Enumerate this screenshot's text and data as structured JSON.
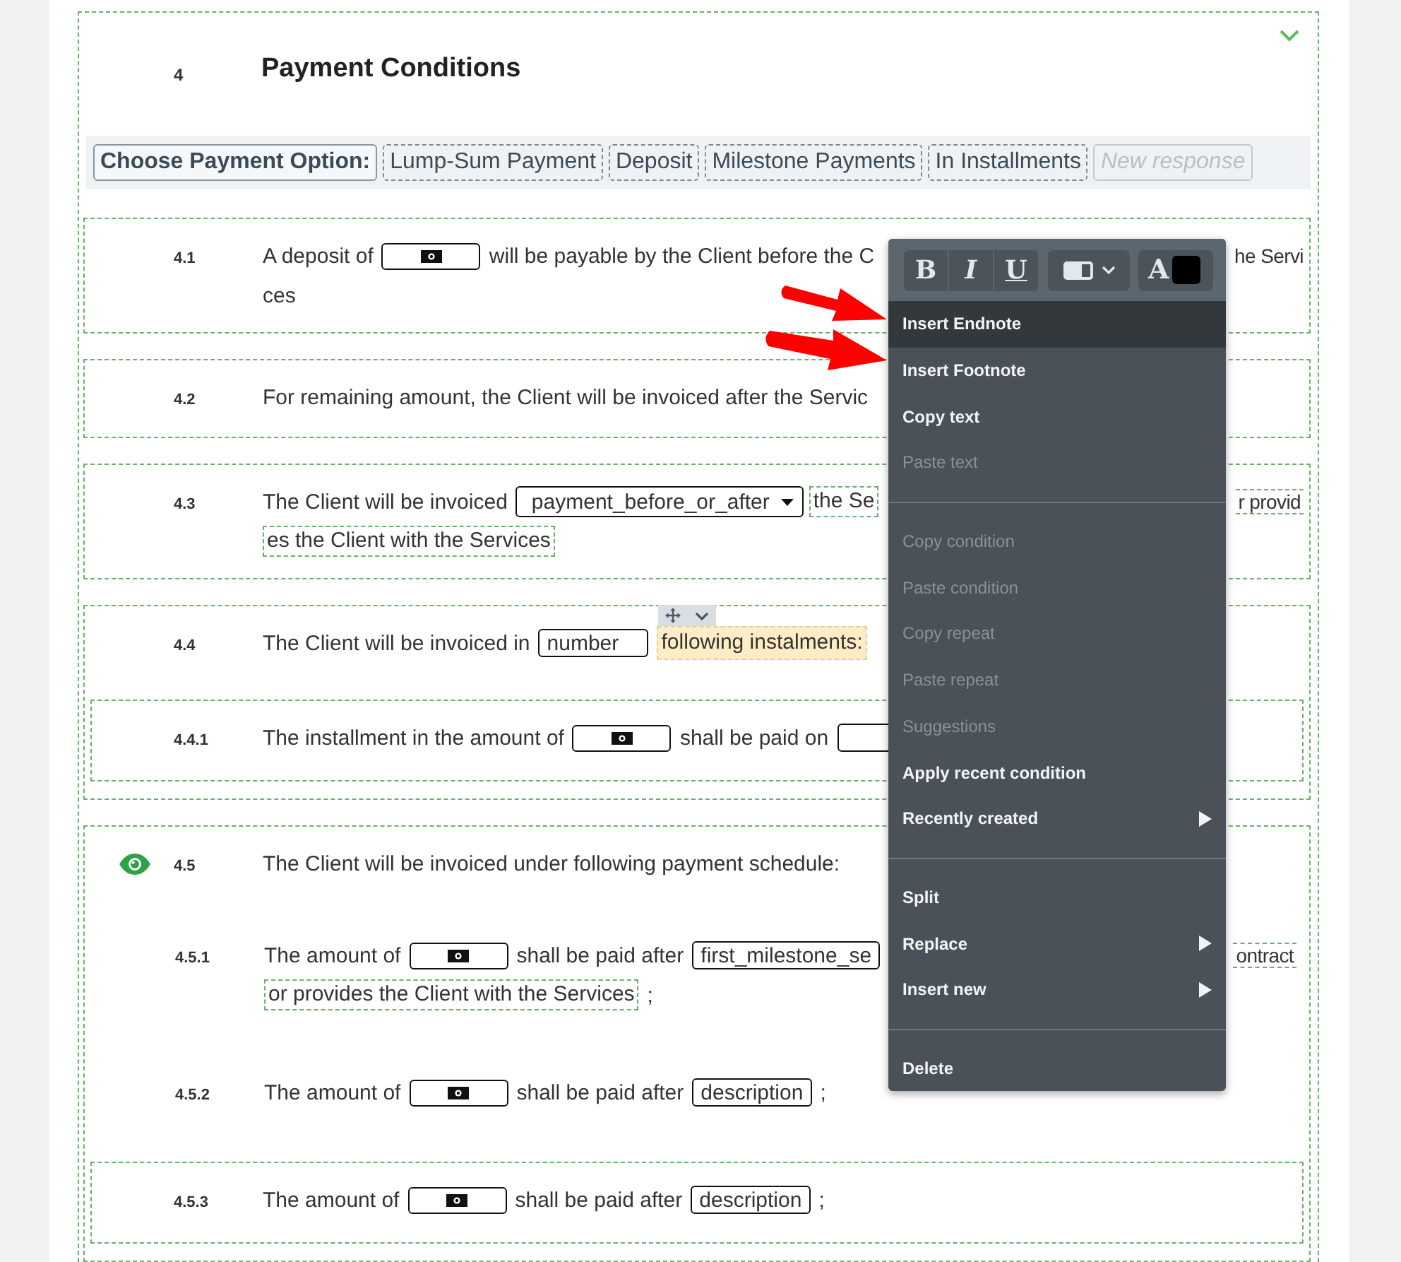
{
  "section": {
    "number": "4",
    "title": "Payment Conditions",
    "collapsed": false
  },
  "option_bar": {
    "label": "Choose Payment Option:",
    "options": [
      {
        "label": "Lump-Sum Payment",
        "kind": "option"
      },
      {
        "label": "Deposit",
        "kind": "option"
      },
      {
        "label": "Milestone Payments",
        "kind": "option"
      },
      {
        "label": "In Installments",
        "kind": "option"
      },
      {
        "label": "New response",
        "kind": "new"
      }
    ]
  },
  "clauses": [
    {
      "number": "4.1",
      "boxed": true,
      "eye": false,
      "lines": [
        {
          "segments": [
            {
              "kind": "text",
              "text": "A deposit of"
            },
            {
              "kind": "money"
            },
            {
              "kind": "text",
              "text": "will be payable by the Client before the C"
            }
          ],
          "tail": {
            "kind": "text",
            "text": "he Servi"
          }
        },
        {
          "segments": [
            {
              "kind": "text",
              "text": "ces"
            }
          ]
        }
      ]
    },
    {
      "number": "4.2",
      "boxed": true,
      "eye": false,
      "lines": [
        {
          "segments": [
            {
              "kind": "text",
              "text": "For remaining amount, the Client will be invoiced after the Servic"
            }
          ]
        }
      ]
    },
    {
      "number": "4.3",
      "boxed": true,
      "eye": false,
      "lines": [
        {
          "segments": [
            {
              "kind": "text",
              "text": "The Client will be invoiced"
            },
            {
              "kind": "dropdown",
              "value": "payment_before_or_after"
            },
            {
              "kind": "conditional",
              "text": "the Se"
            }
          ],
          "tail": {
            "kind": "conditional",
            "text": "r provid"
          }
        },
        {
          "segments": [
            {
              "kind": "conditional",
              "text": "es the Client with the Services"
            }
          ]
        }
      ]
    },
    {
      "number": "4.4",
      "boxed": true,
      "eye": false,
      "lines": [
        {
          "segments": [
            {
              "kind": "text",
              "text": "The Client will be invoiced in"
            },
            {
              "kind": "field",
              "value": "number"
            },
            {
              "kind": "highlight",
              "text": "following instalments:"
            }
          ]
        }
      ],
      "children": [
        {
          "number": "4.4.1",
          "boxed": true,
          "eye": false,
          "lines": [
            {
              "segments": [
                {
                  "kind": "text",
                  "text": "The installment in the amount of"
                },
                {
                  "kind": "money"
                },
                {
                  "kind": "text",
                  "text": "shall be paid on"
                },
                {
                  "kind": "field"
                }
              ]
            }
          ]
        }
      ]
    },
    {
      "number": "4.5",
      "boxed": true,
      "eye": true,
      "lines": [
        {
          "segments": [
            {
              "kind": "text",
              "text": "The Client will be invoiced under following payment schedule:"
            }
          ]
        }
      ],
      "children": [
        {
          "number": "4.5.1",
          "boxed": false,
          "eye": false,
          "lines": [
            {
              "segments": [
                {
                  "kind": "text",
                  "text": "The amount of"
                },
                {
                  "kind": "money"
                },
                {
                  "kind": "text",
                  "text": "shall be paid after"
                },
                {
                  "kind": "field",
                  "value": "first_milestone_se"
                }
              ],
              "tail": {
                "kind": "conditional",
                "text": "ontract"
              }
            },
            {
              "segments": [
                {
                  "kind": "conditional",
                  "text": "or provides the Client with the Services"
                },
                {
                  "kind": "text",
                  "text": ";"
                }
              ]
            }
          ]
        },
        {
          "number": "4.5.2",
          "boxed": false,
          "eye": false,
          "lines": [
            {
              "segments": [
                {
                  "kind": "text",
                  "text": "The amount of"
                },
                {
                  "kind": "money"
                },
                {
                  "kind": "text",
                  "text": "shall be paid after"
                },
                {
                  "kind": "field",
                  "value": "description"
                },
                {
                  "kind": "text",
                  "text": ";"
                }
              ]
            }
          ]
        },
        {
          "number": "4.5.3",
          "boxed": true,
          "eye": false,
          "lines": [
            {
              "segments": [
                {
                  "kind": "text",
                  "text": "The amount of"
                },
                {
                  "kind": "money"
                },
                {
                  "kind": "text",
                  "text": "shall be paid after"
                },
                {
                  "kind": "field",
                  "value": "description"
                },
                {
                  "kind": "text",
                  "text": ";"
                }
              ]
            }
          ]
        }
      ]
    }
  ],
  "context_menu": {
    "toolbar": {
      "format_buttons": [
        {
          "label": "B",
          "kind": "bold"
        },
        {
          "label": "I",
          "kind": "italic"
        },
        {
          "label": "U",
          "kind": "underline"
        }
      ],
      "font_color_label": "A"
    },
    "groups": [
      [
        {
          "label": "Insert Endnote",
          "disabled": false,
          "hovered": true,
          "submenu": false
        },
        {
          "label": "Insert Footnote",
          "disabled": false,
          "hovered": false,
          "submenu": false
        },
        {
          "label": "Copy text",
          "disabled": false,
          "hovered": false,
          "submenu": false
        },
        {
          "label": "Paste text",
          "disabled": true,
          "hovered": false,
          "submenu": false
        }
      ],
      [
        {
          "label": "Copy condition",
          "disabled": true,
          "hovered": false,
          "submenu": false
        },
        {
          "label": "Paste condition",
          "disabled": true,
          "hovered": false,
          "submenu": false
        },
        {
          "label": "Copy repeat",
          "disabled": true,
          "hovered": false,
          "submenu": false
        },
        {
          "label": "Paste repeat",
          "disabled": true,
          "hovered": false,
          "submenu": false
        },
        {
          "label": "Suggestions",
          "disabled": true,
          "hovered": false,
          "submenu": false
        },
        {
          "label": "Apply recent condition",
          "disabled": false,
          "hovered": false,
          "submenu": false
        },
        {
          "label": "Recently created",
          "disabled": false,
          "hovered": false,
          "submenu": true
        }
      ],
      [
        {
          "label": "Split",
          "disabled": false,
          "hovered": false,
          "submenu": false
        },
        {
          "label": "Replace",
          "disabled": false,
          "hovered": false,
          "submenu": true
        },
        {
          "label": "Insert new",
          "disabled": false,
          "hovered": false,
          "submenu": true
        }
      ],
      [
        {
          "label": "Delete",
          "disabled": false,
          "hovered": false,
          "submenu": false
        }
      ]
    ]
  }
}
